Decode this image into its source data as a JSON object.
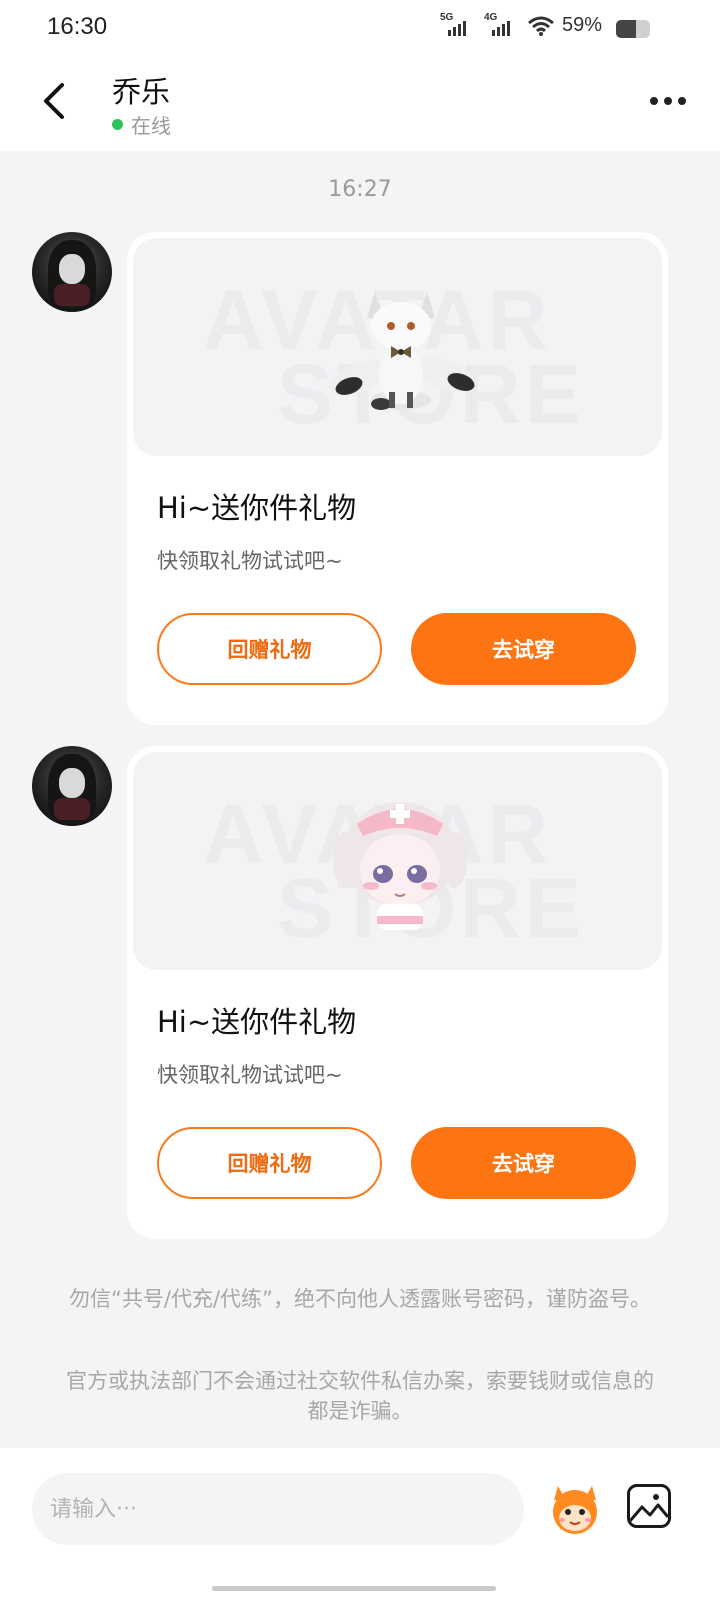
{
  "status_bar": {
    "time": "16:30",
    "network_1": "5G",
    "network_2": "4G",
    "wifi_icon": "wifi-icon",
    "battery_percent": "59%",
    "battery_level": 0.59
  },
  "header": {
    "contact_name": "乔乐",
    "status": "在线",
    "back_icon": "chevron-left-icon",
    "more_icon": "more-horizontal-icon"
  },
  "chat": {
    "timestamp": "16:27",
    "messages": [
      {
        "title": "Hi~送你件礼物",
        "subtitle": "快领取礼物试试吧~",
        "watermark_1": "AVATAR",
        "watermark_2": "STORE",
        "gift_icon": "white-fox-icon",
        "secondary_button": "回赠礼物",
        "primary_button": "去试穿"
      },
      {
        "title": "Hi~送你件礼物",
        "subtitle": "快领取礼物试试吧~",
        "watermark_1": "AVATAR",
        "watermark_2": "STORE",
        "gift_icon": "nurse-girl-icon",
        "secondary_button": "回赠礼物",
        "primary_button": "去试穿"
      }
    ],
    "notice_1": "勿信“共号/代充/代练”，绝不向他人透露账号密码，谨防盗号。",
    "notice_2": "官方或执法部门不会通过社交软件私信办案，索要钱财或信息的都是诈骗。"
  },
  "input_bar": {
    "placeholder": "请输入···",
    "mascot_icon": "orange-mascot-icon",
    "image_icon": "image-icon"
  },
  "colors": {
    "accent": "#fd7413",
    "online": "#2fc25b",
    "background": "#f4f4f6"
  }
}
